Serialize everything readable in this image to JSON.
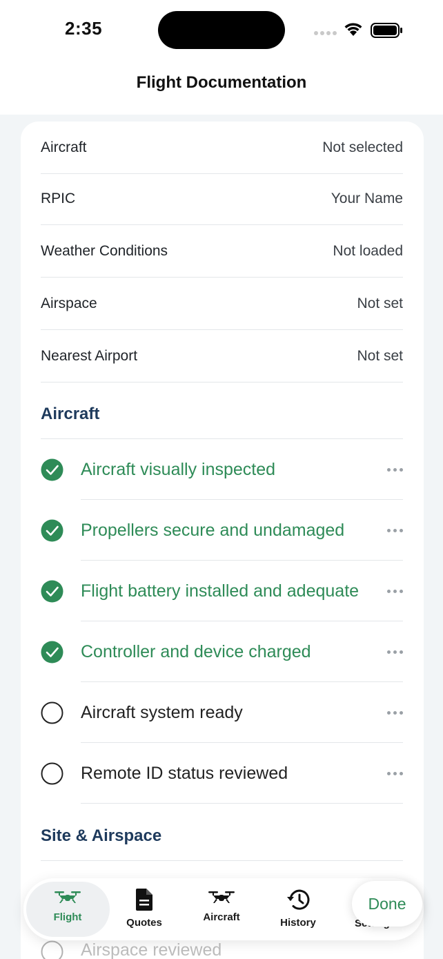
{
  "status_bar": {
    "time": "2:35"
  },
  "nav": {
    "title": "Flight Documentation"
  },
  "info_rows": [
    {
      "label": "Aircraft",
      "value": "Not selected"
    },
    {
      "label": "RPIC",
      "value": "Your Name"
    },
    {
      "label": "Weather Conditions",
      "value": "Not loaded"
    },
    {
      "label": "Airspace",
      "value": "Not set"
    },
    {
      "label": "Nearest Airport",
      "value": "Not set"
    }
  ],
  "sections": {
    "aircraft_title": "Aircraft",
    "site_title": "Site & Airspace"
  },
  "checklist": [
    {
      "text": "Aircraft visually inspected",
      "checked": true
    },
    {
      "text": "Propellers secure and undamaged",
      "checked": true
    },
    {
      "text": "Flight battery installed and adequate",
      "checked": true
    },
    {
      "text": "Controller and device charged",
      "checked": true
    },
    {
      "text": "Aircraft system ready",
      "checked": false
    },
    {
      "text": "Remote ID status reviewed",
      "checked": false
    }
  ],
  "site_items": [
    {
      "text": "Airspace reviewed",
      "checked": false
    }
  ],
  "tab_bar": {
    "tabs": [
      {
        "label": "Flight",
        "icon": "drone-icon",
        "active": true
      },
      {
        "label": "Quotes",
        "icon": "document-icon",
        "active": false
      },
      {
        "label": "Aircraft",
        "icon": "drone-icon",
        "active": false
      },
      {
        "label": "History",
        "icon": "history-icon",
        "active": false
      },
      {
        "label": "Settings",
        "icon": "gear-icon",
        "active": false
      }
    ],
    "done_label": "Done"
  },
  "colors": {
    "accent_green": "#2e8b57",
    "section_navy": "#1e3a5c"
  }
}
